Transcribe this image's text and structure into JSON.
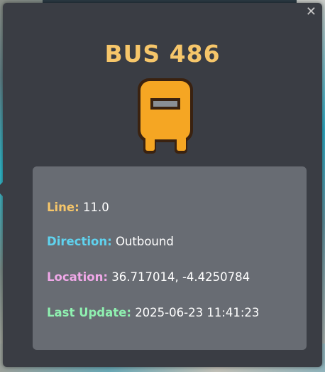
{
  "popup": {
    "title": "BUS 486",
    "close_glyph": "✕",
    "icon": "bus-icon",
    "accent_color": "#f6c66a",
    "icon_color": "#f5a623"
  },
  "details": {
    "line": {
      "label": "Line:",
      "value": "11.0",
      "label_color": "#f6c66a"
    },
    "direction": {
      "label": "Direction:",
      "value": "Outbound",
      "label_color": "#5fd3ef"
    },
    "location": {
      "label": "Location:",
      "value": "36.717014, -4.4250784",
      "label_color": "#f0a8e8"
    },
    "last_update": {
      "label": "Last Update:",
      "value": "2025-06-23 11:41:23",
      "label_color": "#8ff0b0"
    }
  }
}
